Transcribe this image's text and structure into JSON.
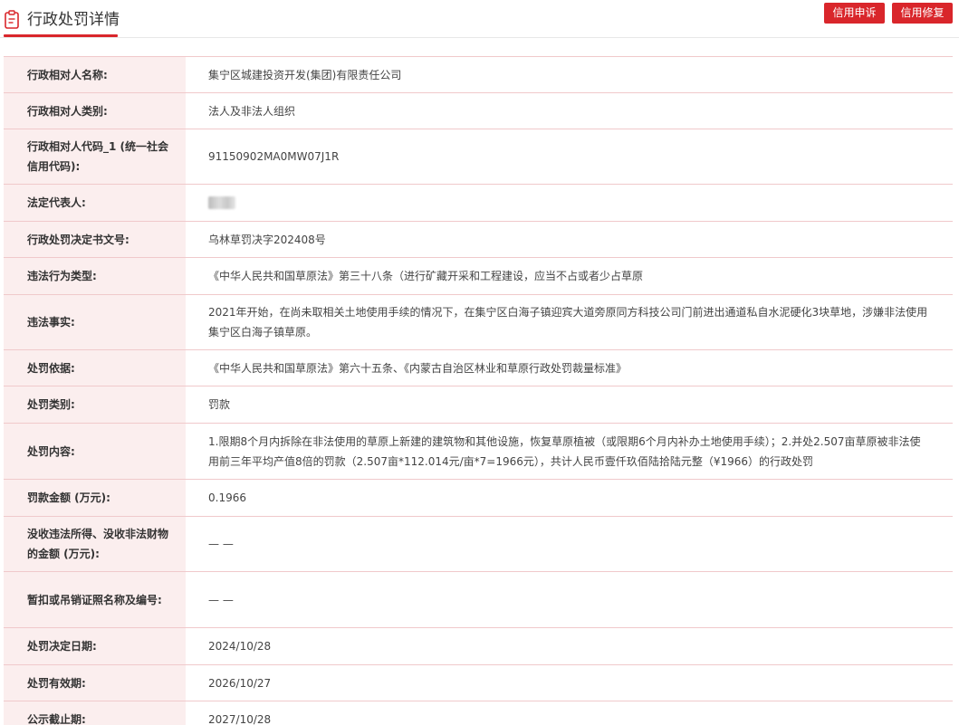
{
  "header": {
    "title": "行政处罚详情",
    "icon": "clipboard-icon",
    "accent_color": "#d9262b",
    "buttons": {
      "appeal": "信用申诉",
      "repair": "信用修复"
    }
  },
  "rows": [
    {
      "label": "行政相对人名称:",
      "value": "集宁区城建投资开发(集团)有限责任公司"
    },
    {
      "label": "行政相对人类别:",
      "value": "法人及非法人组织"
    },
    {
      "label": "行政相对人代码_1 (统一社会信用代码):",
      "value": "91150902MA0MW07J1R"
    },
    {
      "label": "法定代表人:",
      "value": ""
    },
    {
      "label": "行政处罚决定书文号:",
      "value": "乌林草罚决字202408号"
    },
    {
      "label": "违法行为类型:",
      "value": "《中华人民共和国草原法》第三十八条（进行矿藏开采和工程建设，应当不占或者少占草原"
    },
    {
      "label": "违法事实:",
      "value": "2021年开始，在尚未取相关土地使用手续的情况下，在集宁区白海子镇迎宾大道旁原同方科技公司门前进出通道私自水泥硬化3块草地，涉嫌非法使用集宁区白海子镇草原。"
    },
    {
      "label": "处罚依据:",
      "value": "《中华人民共和国草原法》第六十五条、《内蒙古自治区林业和草原行政处罚裁量标准》"
    },
    {
      "label": "处罚类别:",
      "value": "罚款"
    },
    {
      "label": "处罚内容:",
      "value": "1.限期8个月内拆除在非法使用的草原上新建的建筑物和其他设施，恢复草原植被（或限期6个月内补办土地使用手续）；2.并处2.507亩草原被非法使用前三年平均产值8倍的罚款（2.507亩*112.014元/亩*7=1966元），共计人民币壹仟玖佰陆拾陆元整（¥1966）的行政处罚"
    },
    {
      "label": "罚款金额 (万元):",
      "value": "0.1966"
    },
    {
      "label": "没收违法所得、没收非法财物的金额 (万元):",
      "value": "— —"
    },
    {
      "label": "暂扣或吊销证照名称及编号:",
      "value": "— —"
    },
    {
      "label": "处罚决定日期:",
      "value": "2024/10/28"
    },
    {
      "label": "处罚有效期:",
      "value": "2026/10/27"
    },
    {
      "label": "公示截止期:",
      "value": "2027/10/28"
    }
  ]
}
